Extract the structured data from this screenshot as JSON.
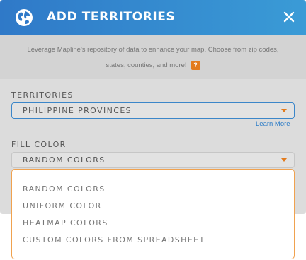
{
  "dialog": {
    "title": "ADD TERRITORIES",
    "icon": "globe-icon",
    "close_icon": "close-icon"
  },
  "intro": {
    "line1": "Leverage Mapline's repository of data to enhance your map. Choose from zip codes,",
    "line2": "states, counties, and more!",
    "help_label": "?"
  },
  "territories": {
    "label": "TERRITORIES",
    "selected": "PHILIPPINE PROVINCES",
    "learn_more": "Learn More"
  },
  "fill_color": {
    "label": "FILL COLOR",
    "selected": "RANDOM COLORS",
    "options": [
      "RANDOM COLORS",
      "UNIFORM COLOR",
      "HEATMAP COLORS",
      "CUSTOM COLORS FROM SPREADSHEET"
    ]
  },
  "colors": {
    "header_start": "#2f79c8",
    "header_end": "#3a9bd6",
    "accent": "#e37b1d",
    "link": "#2e7dc7"
  }
}
